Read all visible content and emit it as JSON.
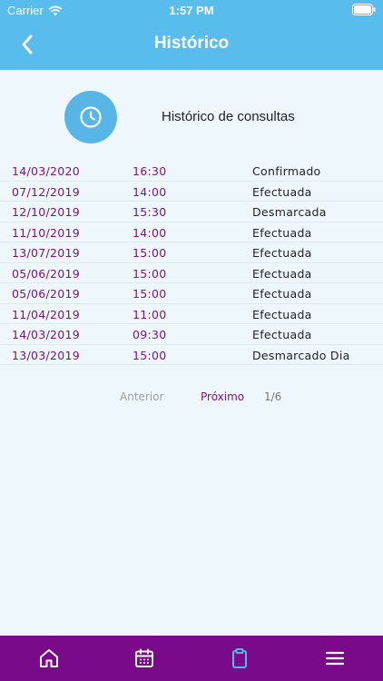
{
  "status_bar": {
    "carrier": "Carrier",
    "time": "1:57 PM"
  },
  "header": {
    "title": "Histórico",
    "back_icon": "chevron-left-icon"
  },
  "section": {
    "title": "Histórico de consultas",
    "icon": "clock-icon"
  },
  "history": [
    {
      "date": "14/03/2020",
      "time": "16:30",
      "status": "Confirmado"
    },
    {
      "date": "07/12/2019",
      "time": "14:00",
      "status": "Efectuada"
    },
    {
      "date": "12/10/2019",
      "time": "15:30",
      "status": "Desmarcada"
    },
    {
      "date": "11/10/2019",
      "time": "14:00",
      "status": "Efectuada"
    },
    {
      "date": "13/07/2019",
      "time": "15:00",
      "status": "Efectuada"
    },
    {
      "date": "05/06/2019",
      "time": "15:00",
      "status": "Efectuada"
    },
    {
      "date": "05/06/2019",
      "time": "15:00",
      "status": "Efectuada"
    },
    {
      "date": "11/04/2019",
      "time": "11:00",
      "status": "Efectuada"
    },
    {
      "date": "14/03/2019",
      "time": "09:30",
      "status": "Efectuada"
    },
    {
      "date": "13/03/2019",
      "time": "15:00",
      "status": "Desmarcado Dia"
    }
  ],
  "pagination": {
    "prev_label": "Anterior",
    "next_label": "Próximo",
    "page_indicator": "1/6"
  },
  "tab_bar": {
    "items": [
      {
        "icon": "home-icon",
        "active": false
      },
      {
        "icon": "calendar-icon",
        "active": false
      },
      {
        "icon": "clipboard-icon",
        "active": true
      },
      {
        "icon": "menu-icon",
        "active": false
      }
    ]
  },
  "colors": {
    "header_bg": "#58bcec",
    "accent_purple": "#7a1480",
    "tab_bar_bg": "#7b0a8a",
    "active_tab": "#58b6e6",
    "page_bg": "#eef7fc"
  }
}
